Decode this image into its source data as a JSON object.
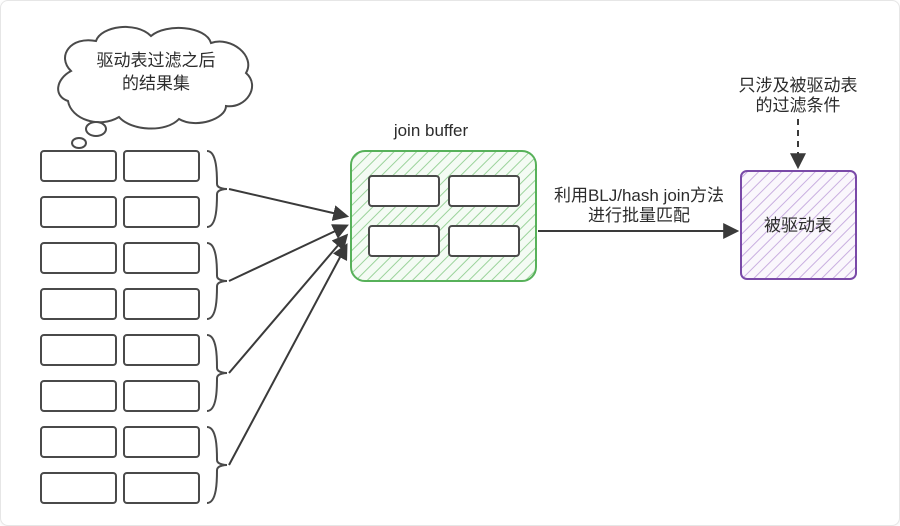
{
  "speechBubble": {
    "line1": "驱动表过滤之后",
    "line2": "的结果集"
  },
  "joinBuffer": {
    "title": "join buffer"
  },
  "arrowLabel": {
    "line1": "利用BLJ/hash join方法",
    "line2": "进行批量匹配"
  },
  "rightBox": {
    "label": "被驱动表"
  },
  "rightAnnotation": {
    "line1": "只涉及被驱动表",
    "line2": "的过滤条件"
  }
}
